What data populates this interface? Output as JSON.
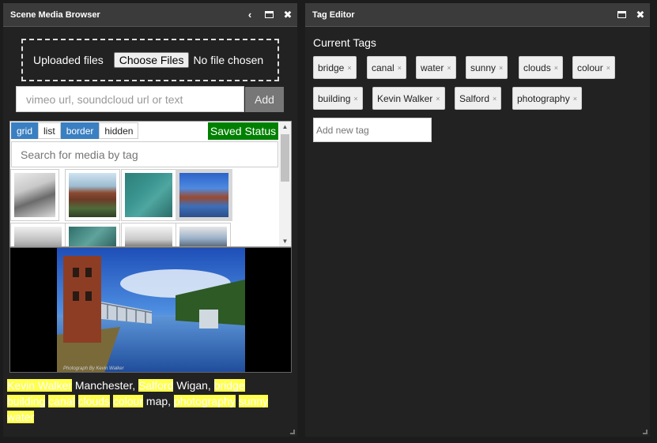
{
  "media_browser": {
    "title": "Scene Media Browser",
    "header_buttons": [
      "chevron-left-icon",
      "maximize-icon",
      "close-icon"
    ],
    "upload": {
      "label": "Uploaded files",
      "choose_button": "Choose Files",
      "no_file_text": "No file chosen"
    },
    "url_input": {
      "placeholder": "vimeo url, soundcloud url or text",
      "value": ""
    },
    "add_button": "Add",
    "view_tabs": [
      {
        "label": "grid",
        "active": true
      },
      {
        "label": "list",
        "active": false
      },
      {
        "label": "border",
        "active": true
      },
      {
        "label": "hidden",
        "active": false
      }
    ],
    "saved_status": "Saved Status",
    "search": {
      "placeholder": "Search for media by tag",
      "value": ""
    },
    "media_tags": [
      {
        "text": "Kevin Walker",
        "highlighted": true
      },
      {
        "text": "Manchester,",
        "highlighted": false
      },
      {
        "text": "Salford",
        "highlighted": true
      },
      {
        "text": "Wigan,",
        "highlighted": false
      },
      {
        "text": "bridge",
        "highlighted": true
      },
      {
        "text": "building",
        "highlighted": true
      },
      {
        "text": "canal",
        "highlighted": true
      },
      {
        "text": "clouds",
        "highlighted": true
      },
      {
        "text": "colour",
        "highlighted": true
      },
      {
        "text": "map,",
        "highlighted": false
      },
      {
        "text": "photography",
        "highlighted": true
      },
      {
        "text": "sunny",
        "highlighted": true
      },
      {
        "text": "water",
        "highlighted": true
      }
    ],
    "preview_watermark": "Photograph By Kevin Walker"
  },
  "tag_editor": {
    "title": "Tag Editor",
    "header_buttons": [
      "maximize-icon",
      "close-icon"
    ],
    "current_tags_title": "Current Tags",
    "tags": [
      "bridge",
      "canal",
      "water",
      "sunny",
      "clouds",
      "colour",
      "building",
      "Kevin Walker",
      "Salford",
      "photography"
    ],
    "remove_symbol": "×",
    "new_tag_placeholder": "Add new tag"
  },
  "colors": {
    "highlight": "#ffff4d",
    "active_tab": "#3a7fc1",
    "saved_status": "#008000"
  }
}
